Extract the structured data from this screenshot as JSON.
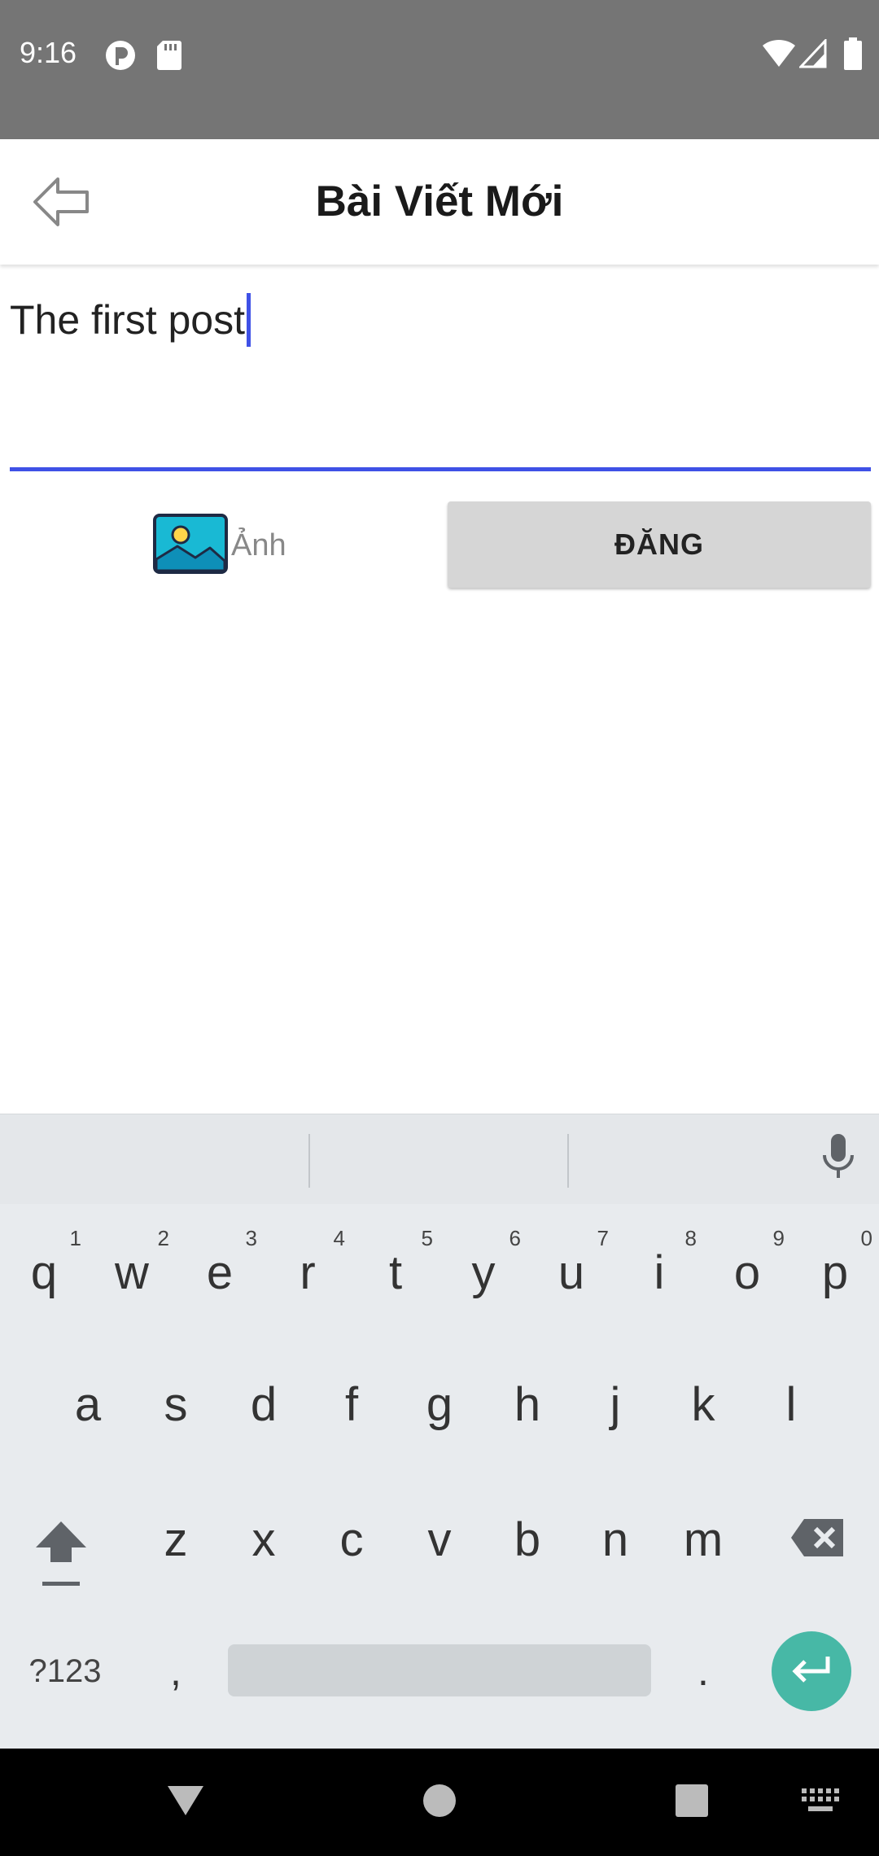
{
  "status_bar": {
    "time": "9:16",
    "icons": [
      "notification-icon",
      "sd-card-icon",
      "wifi-icon",
      "signal-icon",
      "battery-icon"
    ],
    "background": "#757575"
  },
  "app_bar": {
    "title": "Bài Viết Mới",
    "back_icon": "arrow-left-icon"
  },
  "post_input": {
    "value": "The first post",
    "accent": "#3f51e6"
  },
  "actions": {
    "photo_label": "Ảnh",
    "photo_icon": "image-icon",
    "post_label": "ĐĂNG"
  },
  "keyboard": {
    "row1": [
      {
        "key": "q",
        "hint": "1"
      },
      {
        "key": "w",
        "hint": "2"
      },
      {
        "key": "e",
        "hint": "3"
      },
      {
        "key": "r",
        "hint": "4"
      },
      {
        "key": "t",
        "hint": "5"
      },
      {
        "key": "y",
        "hint": "6"
      },
      {
        "key": "u",
        "hint": "7"
      },
      {
        "key": "i",
        "hint": "8"
      },
      {
        "key": "o",
        "hint": "9"
      },
      {
        "key": "p",
        "hint": "0"
      }
    ],
    "row2": [
      "a",
      "s",
      "d",
      "f",
      "g",
      "h",
      "j",
      "k",
      "l"
    ],
    "row3": [
      "z",
      "x",
      "c",
      "v",
      "b",
      "n",
      "m"
    ],
    "symbols_label": "?123",
    "comma": ",",
    "period": ".",
    "enter_color": "#47b8a6"
  },
  "nav_bar": {
    "icons": [
      "back-triangle-icon",
      "home-circle-icon",
      "recents-square-icon",
      "keyboard-switch-icon"
    ]
  }
}
